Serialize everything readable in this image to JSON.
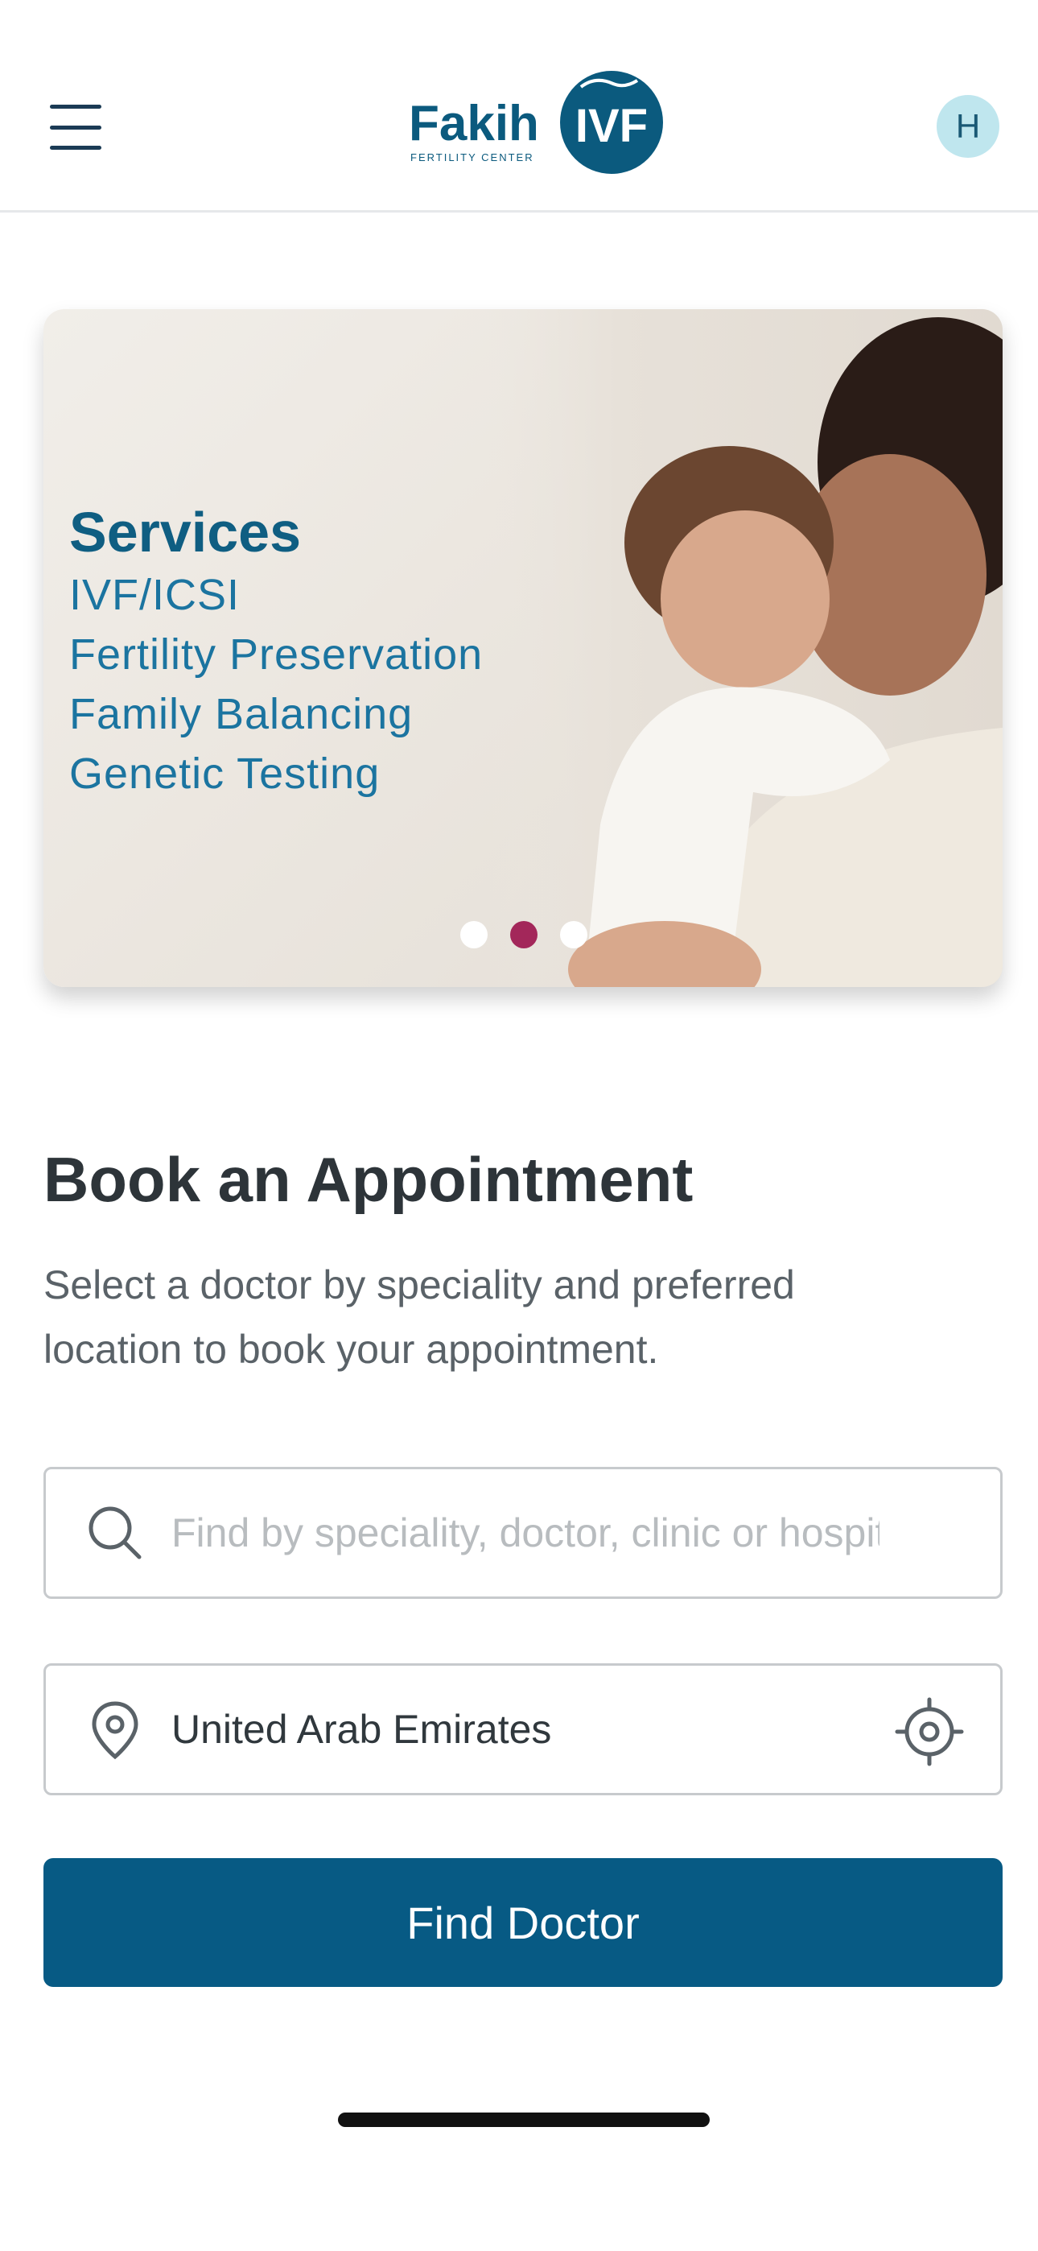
{
  "header": {
    "logo_text": "Fakih",
    "logo_badge": "IVF",
    "logo_tagline": "FERTILITY CENTER",
    "avatar_initial": "H",
    "menu_icon": "hamburger-icon"
  },
  "banner": {
    "title": "Services",
    "lines": [
      "IVF/ICSI",
      "Fertility Preservation",
      "Family Balancing",
      "Genetic Testing"
    ],
    "slides_total": 3,
    "active_slide": 2
  },
  "booking": {
    "title": "Book an Appointment",
    "subtitle": "Select a doctor by speciality and preferred location to book your appointment.",
    "search_placeholder": "Find by speciality, doctor, clinic or hospital",
    "search_icon": "search-icon",
    "location_value": "United Arab Emirates",
    "location_icon": "location-pin-icon",
    "locate_icon": "crosshair-icon",
    "find_button": "Find Doctor"
  },
  "colors": {
    "primary": "#075a84",
    "dot_active": "#a3275a",
    "title": "#2d3439",
    "avatar_bg": "#bfe6ee"
  }
}
